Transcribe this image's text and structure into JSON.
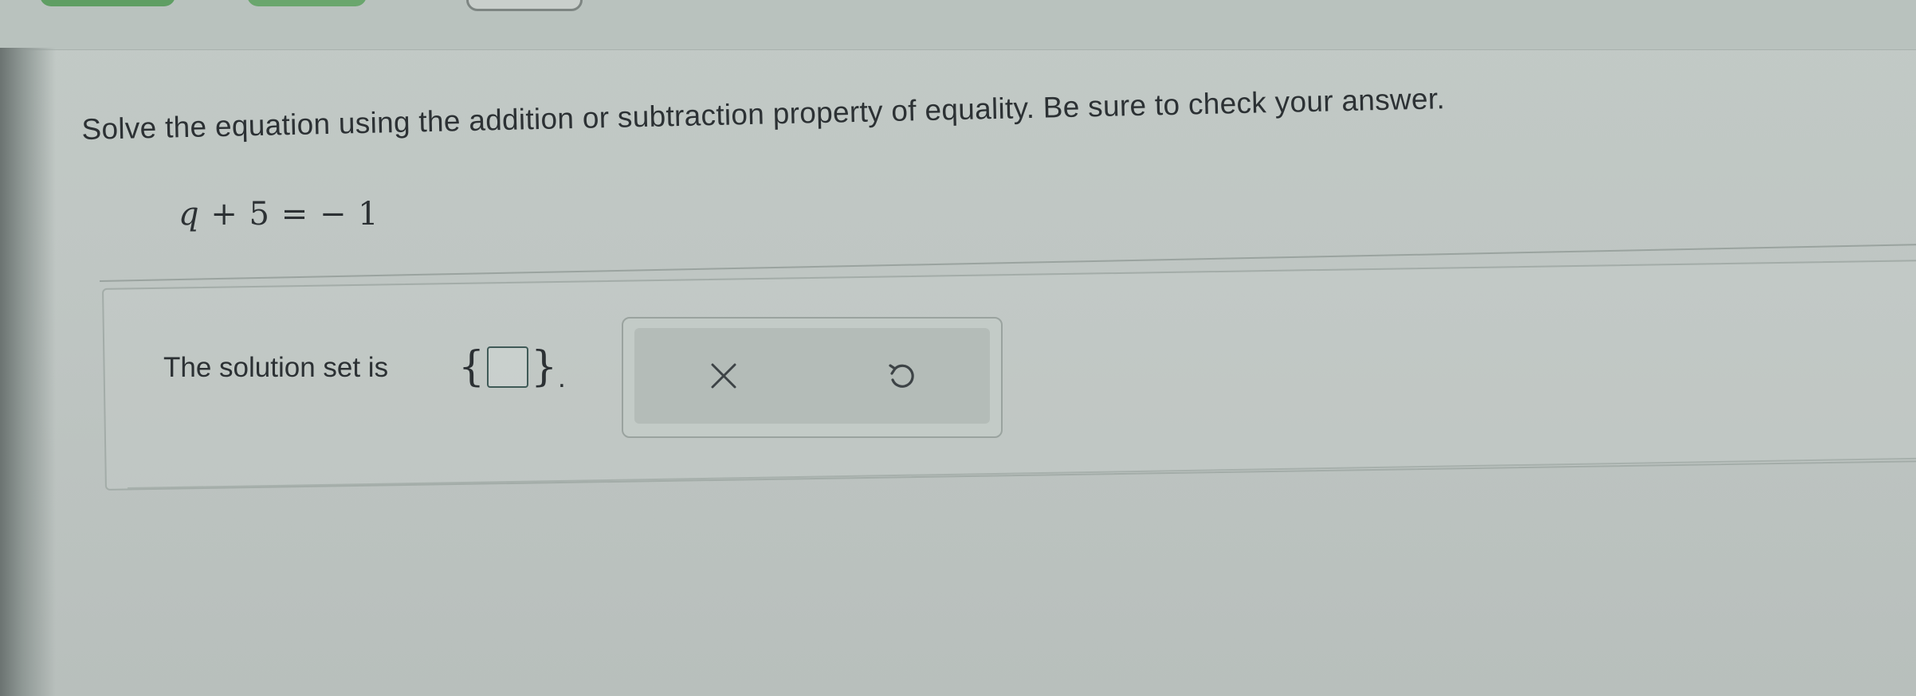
{
  "question": {
    "instruction": "Solve the equation using the addition or subtraction property of equality. Be sure to check your answer.",
    "equation": {
      "variable": "q",
      "rest": "+ 5 = − 1"
    }
  },
  "answer": {
    "label": "The solution set is",
    "open_brace": "{",
    "close_brace": "}",
    "value": "",
    "period": "."
  },
  "actions": {
    "clear_icon": "close-icon",
    "undo_icon": "undo-icon"
  },
  "colors": {
    "text": "#2c3134",
    "box_border": "#3f5a57",
    "background": "#c2cac6"
  }
}
